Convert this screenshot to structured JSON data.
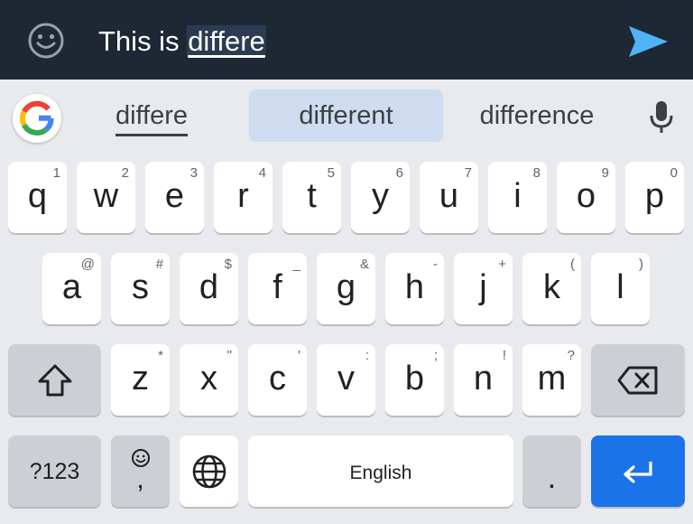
{
  "composer": {
    "text_before": "This is ",
    "composing_word": "differe"
  },
  "suggestions": {
    "left": "differe",
    "middle": "different",
    "right": "difference"
  },
  "keyboard": {
    "row1": [
      {
        "char": "q",
        "hint": "1"
      },
      {
        "char": "w",
        "hint": "2"
      },
      {
        "char": "e",
        "hint": "3"
      },
      {
        "char": "r",
        "hint": "4"
      },
      {
        "char": "t",
        "hint": "5"
      },
      {
        "char": "y",
        "hint": "6"
      },
      {
        "char": "u",
        "hint": "7"
      },
      {
        "char": "i",
        "hint": "8"
      },
      {
        "char": "o",
        "hint": "9"
      },
      {
        "char": "p",
        "hint": "0"
      }
    ],
    "row2": [
      {
        "char": "a",
        "hint": "@"
      },
      {
        "char": "s",
        "hint": "#"
      },
      {
        "char": "d",
        "hint": "$"
      },
      {
        "char": "f",
        "hint": "_"
      },
      {
        "char": "g",
        "hint": "&"
      },
      {
        "char": "h",
        "hint": "-"
      },
      {
        "char": "j",
        "hint": "+"
      },
      {
        "char": "k",
        "hint": "("
      },
      {
        "char": "l",
        "hint": ")"
      }
    ],
    "row3": [
      {
        "char": "z",
        "hint": "*"
      },
      {
        "char": "x",
        "hint": "\""
      },
      {
        "char": "c",
        "hint": "'"
      },
      {
        "char": "v",
        "hint": ":"
      },
      {
        "char": "b",
        "hint": ";"
      },
      {
        "char": "n",
        "hint": "!"
      },
      {
        "char": "m",
        "hint": "?"
      }
    ],
    "symbols_label": "?123",
    "comma": ",",
    "space_label": "English",
    "period": "."
  },
  "icons": {
    "emoji": "emoji-face-icon",
    "send": "send-icon",
    "google": "google-g-icon",
    "mic": "mic-icon",
    "shift": "shift-icon",
    "backspace": "backspace-icon",
    "emoji_small": "emoji-small-icon",
    "globe": "globe-icon",
    "enter": "enter-icon"
  },
  "colors": {
    "topbar": "#1e2734",
    "send": "#4fb3f6",
    "enter_key": "#1a73e8",
    "suggestion_highlight": "#cfdcf0"
  }
}
